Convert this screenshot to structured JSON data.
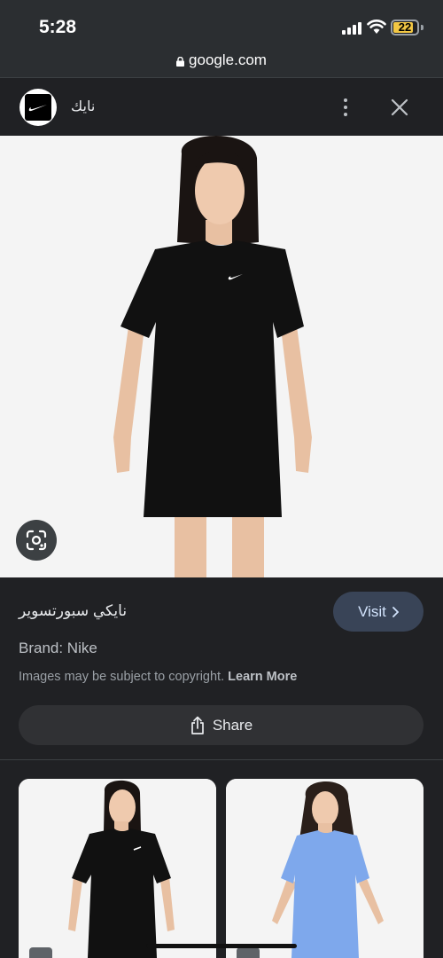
{
  "status_bar": {
    "time": "5:28",
    "battery": "22"
  },
  "url_bar": {
    "domain": "google.com"
  },
  "header": {
    "site_name": "نايك",
    "more_icon": "more-vert-icon",
    "close_icon": "close-icon"
  },
  "main_image": {
    "alt": "Girl wearing black Nike T-shirt dress",
    "lens_icon": "google-lens-icon"
  },
  "product": {
    "title": "نايكي سبورتسوير",
    "visit_label": "Visit",
    "brand": "Brand: Nike",
    "copyright_text": "Images may be subject to copyright.",
    "learn_more_label": "Learn More",
    "share_label": "Share"
  },
  "related": [
    {
      "alt": "Girl in black Nike T-shirt dress",
      "dress_color": "#111111"
    },
    {
      "alt": "Girl in blue Nike T-shirt dress",
      "dress_color": "#7ea8ec"
    }
  ],
  "colors": {
    "background": "#202124",
    "visit_button": "#394457",
    "share_button": "#303134",
    "battery": "#f2c744"
  }
}
